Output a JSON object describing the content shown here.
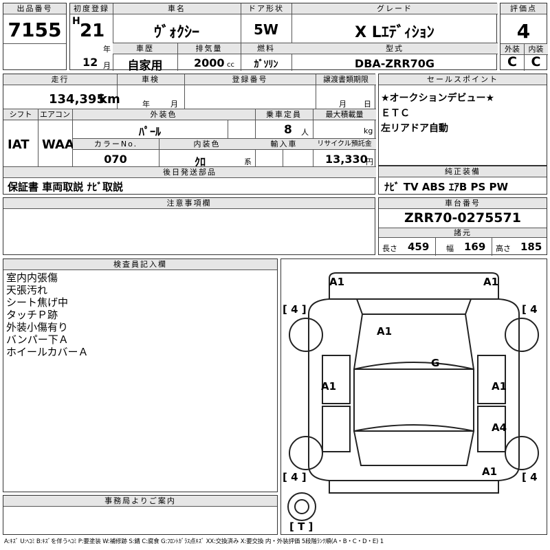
{
  "top": {
    "lot_no_label": "出品番号",
    "lot_no": "7155",
    "first_reg_label": "初度登録",
    "era": "H",
    "year": "21",
    "year_unit": "年",
    "month": "12",
    "month_unit": "月",
    "car_name_label": "車名",
    "car_name": "ｳﾞｫｸｼｰ",
    "door_label": "ドア形状",
    "door": "5W",
    "grade_label": "グレード",
    "grade": "X Lｴﾃﾞｨｼｮﾝ",
    "score_label": "評価点",
    "score": "4",
    "history_label": "車歴",
    "history": "自家用",
    "disp_label": "排気量",
    "disp": "2000",
    "disp_unit": "cc",
    "fuel_label": "燃料",
    "fuel": "ｶﾞｿﾘﾝ",
    "model_label": "型式",
    "model": "DBA-ZRR70G",
    "ext_label": "外装",
    "ext": "C",
    "int_label": "内装",
    "int": "C"
  },
  "mid": {
    "mileage_label": "走行",
    "mileage": "134,395",
    "mileage_unit": "km",
    "inspect_label": "車検",
    "inspect_year_unit": "年",
    "inspect_month_unit": "月",
    "reg_label": "登録番号",
    "transfer_label": "譲渡書類期限",
    "transfer_month_unit": "月",
    "transfer_day_unit": "日",
    "shift_label": "シフト",
    "shift": "IAT",
    "ac_label": "エアコン",
    "ac": "WAA",
    "color_label": "外装色",
    "color": "ﾊﾟｰﾙ",
    "seat_label": "乗車定員",
    "seats": "8",
    "seats_unit": "人",
    "load_label": "最大積載量",
    "load_unit": "kg",
    "color_no_label": "カラーNo.",
    "color_no": "070",
    "int_color_label": "内装色",
    "int_color": "ｸﾛ",
    "int_color_unit": "系",
    "import_label": "輸入車",
    "recycle_label": "リサイクル預託金",
    "recycle": "13,330",
    "recycle_unit": "円",
    "parts_label": "後日発送部品",
    "parts": "保証書 車両取説 ﾅﾋﾞ取説",
    "sales_label": "セールスポイント",
    "sales": [
      "★オークションデビュー★",
      "ＥＴＣ",
      "左リアドア自動"
    ],
    "equip_label": "純正装備",
    "equip": "ﾅﾋﾞ TV ABS ｴｱB PS PW",
    "notes_label": "注意事項欄",
    "chassis_label": "車台番号",
    "chassis": "ZRR70-0275571",
    "specs_label": "諸元",
    "length_label": "長さ",
    "length": "459",
    "width_label": "幅",
    "width": "169",
    "height_label": "高さ",
    "height": "185"
  },
  "inspector": {
    "label": "検査員記入欄",
    "lines": [
      "室内内張傷",
      "天張汚れ",
      "シート焦げ中",
      "タッチＰ跡",
      "外装小傷有り",
      "バンパー下Ａ",
      "ホイールカバーＡ"
    ]
  },
  "diagram": {
    "marks": {
      "front_left": "A1",
      "front_right": "A1",
      "hood": "A1",
      "roof": "G",
      "left_mid": "A1",
      "right_mid": "A1",
      "right_rear": "A4",
      "rear_right": "A1"
    },
    "tires": {
      "fl": "4",
      "fr": "4",
      "rl": "4",
      "rr": "4",
      "spare": "T"
    }
  },
  "office_label": "事務局よりご案内",
  "legend": "A:ｷｽﾞ U:ﾍｺﾐ B:ｷｽﾞを伴うﾍｺﾐ P:要塗装 W:補修跡 S:錆 C:腐食 G:ﾌﾛﾝﾄｶﾞﾗｽ点ｷｽﾞ XX:交換済み X:要交換  内・外装評価 5段階ﾗﾝｸ順(A・B・C・D・E) 1"
}
